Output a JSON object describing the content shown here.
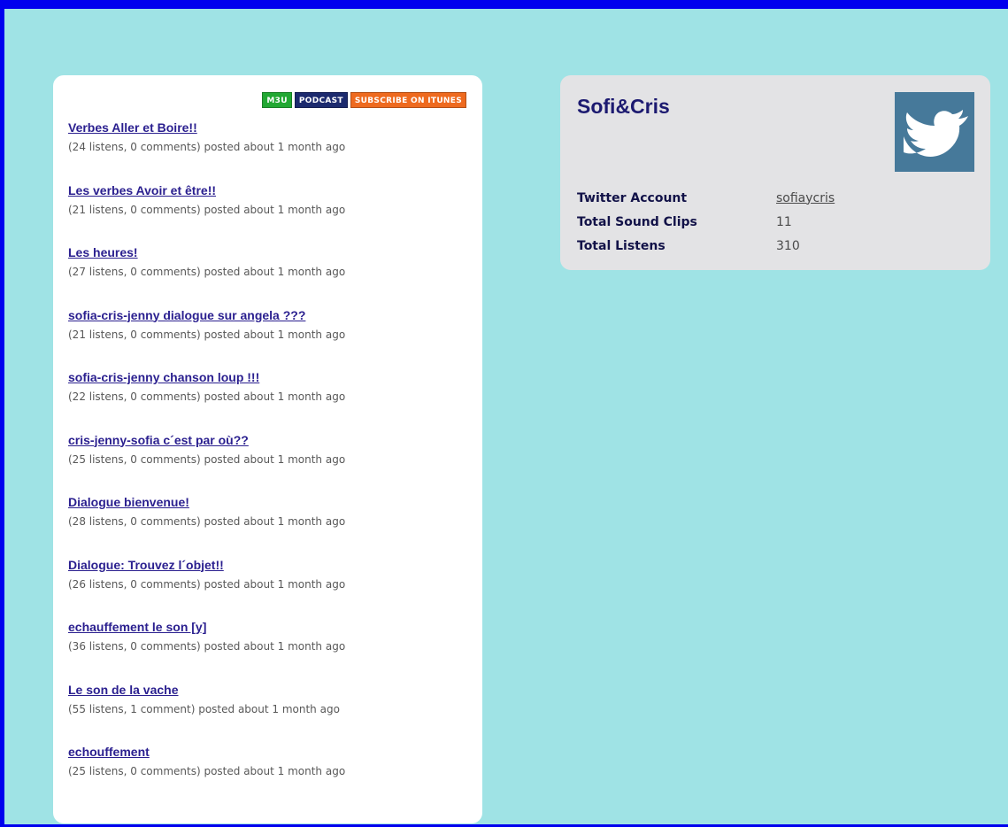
{
  "badges": [
    {
      "label": "M3U",
      "color": "#22a833"
    },
    {
      "label": "PODCAST",
      "color": "#1c2a6e"
    },
    {
      "label": "SUBSCRIBE ON ITUNES",
      "color": "#ee6a1f"
    }
  ],
  "clips": [
    {
      "title": "Verbes Aller et Boire!!",
      "meta": "(24 listens, 0 comments) posted about 1 month ago"
    },
    {
      "title": "Les verbes Avoir et être!!",
      "meta": "(21 listens, 0 comments) posted about 1 month ago"
    },
    {
      "title": "Les heures!",
      "meta": "(27 listens, 0 comments) posted about 1 month ago"
    },
    {
      "title": "sofia-cris-jenny dialogue sur angela ???",
      "meta": "(21 listens, 0 comments) posted about 1 month ago"
    },
    {
      "title": "sofia-cris-jenny chanson loup !!!",
      "meta": "(22 listens, 0 comments) posted about 1 month ago"
    },
    {
      "title": "cris-jenny-sofia c´est par où??",
      "meta": "(25 listens, 0 comments) posted about 1 month ago"
    },
    {
      "title": "Dialogue bienvenue!",
      "meta": "(28 listens, 0 comments) posted about 1 month ago"
    },
    {
      "title": "Dialogue: Trouvez l´objet!!",
      "meta": "(26 listens, 0 comments) posted about 1 month ago"
    },
    {
      "title": "echauffement le son [y]",
      "meta": "(36 listens, 0 comments) posted about 1 month ago"
    },
    {
      "title": "Le son de la vache",
      "meta": "(55 listens, 1 comment) posted about 1 month ago"
    },
    {
      "title": "echouffement",
      "meta": "(25 listens, 0 comments) posted about 1 month ago"
    }
  ],
  "profile": {
    "name": "Sofi&Cris",
    "avatar_icon": "twitter-bird-icon",
    "avatar_color": "#46799a",
    "stats": [
      {
        "label": "Twitter Account",
        "value": "sofiaycris",
        "link": true
      },
      {
        "label": "Total Sound Clips",
        "value": "11",
        "link": false
      },
      {
        "label": "Total Listens",
        "value": "310",
        "link": false
      }
    ]
  }
}
